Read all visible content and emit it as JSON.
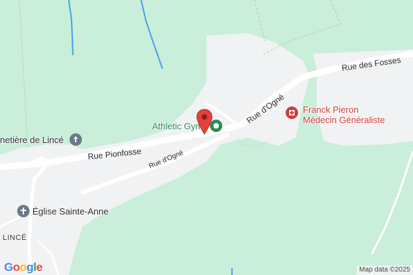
{
  "map": {
    "colors": {
      "land_green": "#c9eed9",
      "builtup": "#f1f2f3",
      "road": "#ffffff",
      "water": "#4aa0ea",
      "poi_green": "#2e8b57",
      "poi_red": "#d23b3b",
      "pin_red": "#e5403b"
    },
    "roads": {
      "rue_des_fosses": "Rue des Fosses",
      "rue_d_ogne_upper": "Rue d'Ogné",
      "rue_d_ogne_lower": "Rue d'Ogné",
      "rue_pionfosse": "Rue Pionfosse"
    },
    "pois": {
      "athletic_gym": {
        "name": "Athletic Gym",
        "icon": "gym-icon"
      },
      "doctor": {
        "line1": "Franck Pieron",
        "line2": "Médecin Généraliste",
        "icon": "medical-cross-icon"
      },
      "cemetery": {
        "name": "netière de Lincé",
        "icon": "cemetery-icon"
      },
      "church": {
        "name": "Église Sainte-Anne",
        "icon": "church-cross-icon"
      }
    },
    "places": {
      "village": "LINCÉ"
    },
    "marker": {
      "icon": "location-pin-icon"
    },
    "branding": {
      "logo_letters": [
        "G",
        "o",
        "o",
        "g",
        "l",
        "e"
      ],
      "logo_colors": [
        "#4285f4",
        "#ea4335",
        "#fbbc05",
        "#4285f4",
        "#34a853",
        "#ea4335"
      ],
      "attribution": "Map data ©2025"
    }
  }
}
